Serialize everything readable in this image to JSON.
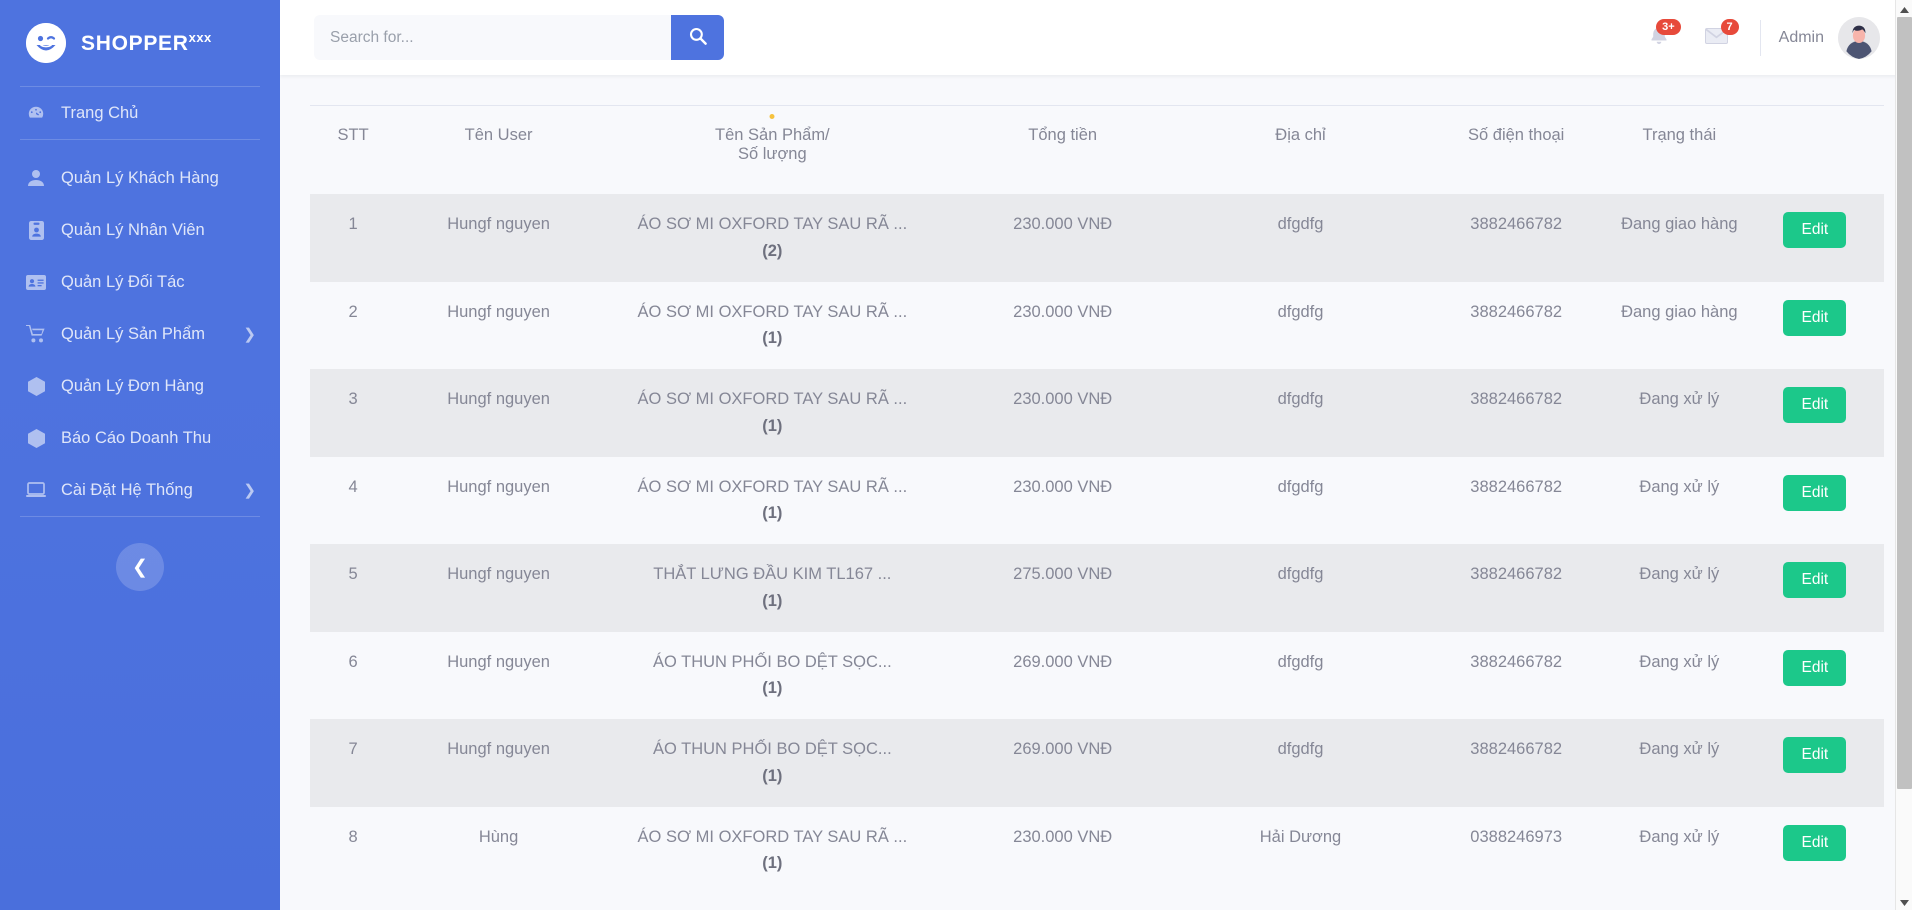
{
  "sidebar": {
    "brand": {
      "name": "SHOPPER",
      "suffix": "xxx",
      "logo_icon": "smiley-wink-icon"
    },
    "items": [
      {
        "label": "Trang Chủ",
        "icon": "tachometer-icon",
        "caret": false
      },
      {
        "label": "Quản Lý Khách Hàng",
        "icon": "user-icon",
        "caret": false
      },
      {
        "label": "Quản Lý Nhân Viên",
        "icon": "id-badge-icon",
        "caret": false
      },
      {
        "label": "Quản Lý Đối Tác",
        "icon": "id-card-icon",
        "caret": false
      },
      {
        "label": "Quản Lý Sản Phẩm",
        "icon": "shopping-cart-icon",
        "caret": true
      },
      {
        "label": "Quản Lý Đơn Hàng",
        "icon": "cube-icon",
        "caret": false
      },
      {
        "label": "Báo Cáo Doanh Thu",
        "icon": "cube-icon",
        "caret": false
      },
      {
        "label": "Cài Đặt Hệ Thống",
        "icon": "laptop-icon",
        "caret": true
      }
    ],
    "collapse_icon": "chevron-left-icon",
    "caret_glyph": "❯",
    "collapse_glyph": "❮",
    "bg_color": "#4e73df"
  },
  "topbar": {
    "search": {
      "placeholder": "Search for...",
      "value": "",
      "button_icon": "search-icon"
    },
    "notifications": {
      "icon": "bell-icon",
      "badge": "3+"
    },
    "messages": {
      "icon": "envelope-icon",
      "badge": "7"
    },
    "user": {
      "name": "Admin",
      "avatar_icon": "avatar-icon"
    },
    "badge_color": "#e74a3b",
    "accent_color": "#4e73df"
  },
  "table": {
    "columns": [
      {
        "key": "stt",
        "label": "STT",
        "dot": false
      },
      {
        "key": "user",
        "label": "Tên User",
        "dot": false
      },
      {
        "key": "product",
        "label": "Tên Sản Phẩm/",
        "label2": "Số lượng",
        "dot": true
      },
      {
        "key": "total",
        "label": "Tổng tiền",
        "dot": false
      },
      {
        "key": "address",
        "label": "Địa chỉ",
        "dot": false
      },
      {
        "key": "phone",
        "label": "Số điện thoại",
        "dot": false
      },
      {
        "key": "status",
        "label": "Trạng thái",
        "dot": false
      },
      {
        "key": "action",
        "label": "",
        "dot": false
      }
    ],
    "edit_label": "Edit",
    "edit_color": "#1cc88a",
    "dot_color": "#f6c23e",
    "rows": [
      {
        "stt": "1",
        "user": "Hungf nguyen",
        "product": "ÁO SƠ MI OXFORD TAY SAU RÃ ...",
        "qty": "(2)",
        "total": "230.000 VNĐ",
        "address": "dfgdfg",
        "phone": "3882466782",
        "status": "Đang giao hàng"
      },
      {
        "stt": "2",
        "user": "Hungf nguyen",
        "product": "ÁO SƠ MI OXFORD TAY SAU RÃ ...",
        "qty": "(1)",
        "total": "230.000 VNĐ",
        "address": "dfgdfg",
        "phone": "3882466782",
        "status": "Đang giao hàng"
      },
      {
        "stt": "3",
        "user": "Hungf nguyen",
        "product": "ÁO SƠ MI OXFORD TAY SAU RÃ ...",
        "qty": "(1)",
        "total": "230.000 VNĐ",
        "address": "dfgdfg",
        "phone": "3882466782",
        "status": "Đang xử lý"
      },
      {
        "stt": "4",
        "user": "Hungf nguyen",
        "product": "ÁO SƠ MI OXFORD TAY SAU RÃ ...",
        "qty": "(1)",
        "total": "230.000 VNĐ",
        "address": "dfgdfg",
        "phone": "3882466782",
        "status": "Đang xử lý"
      },
      {
        "stt": "5",
        "user": "Hungf nguyen",
        "product": "THẮT LƯNG ĐẦU KIM TL167 ...",
        "qty": "(1)",
        "total": "275.000 VNĐ",
        "address": "dfgdfg",
        "phone": "3882466782",
        "status": "Đang xử lý"
      },
      {
        "stt": "6",
        "user": "Hungf nguyen",
        "product": "ÁO THUN PHỐI BO DỆT SỌC...",
        "qty": "(1)",
        "total": "269.000 VNĐ",
        "address": "dfgdfg",
        "phone": "3882466782",
        "status": "Đang xử lý"
      },
      {
        "stt": "7",
        "user": "Hungf nguyen",
        "product": "ÁO THUN PHỐI BO DỆT SỌC...",
        "qty": "(1)",
        "total": "269.000 VNĐ",
        "address": "dfgdfg",
        "phone": "3882466782",
        "status": "Đang xử lý"
      },
      {
        "stt": "8",
        "user": "Hùng",
        "product": "ÁO SƠ MI OXFORD TAY SAU RÃ ...",
        "qty": "(1)",
        "total": "230.000 VNĐ",
        "address": "Hải Dương",
        "phone": "0388246973",
        "status": "Đang xử lý"
      }
    ]
  },
  "scrollbar": {
    "up_icon": "caret-up-icon",
    "down_icon": "caret-down-icon"
  }
}
